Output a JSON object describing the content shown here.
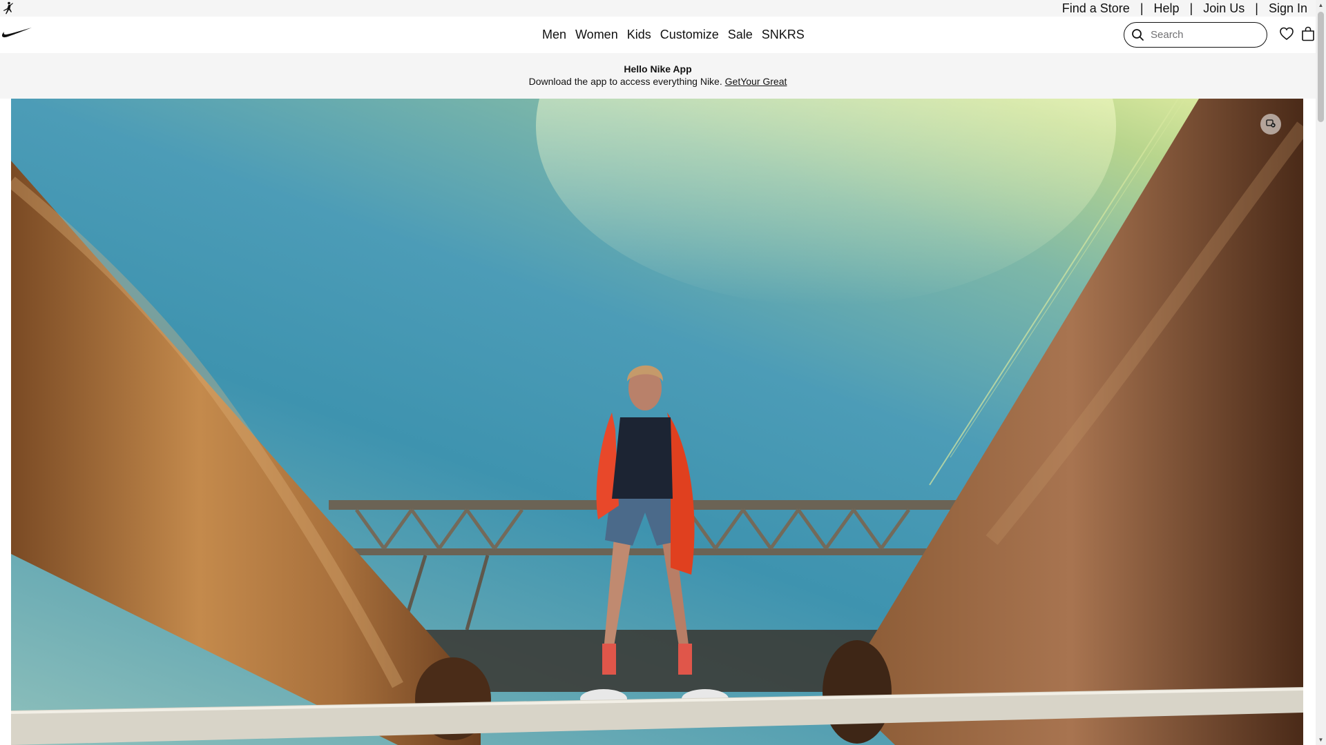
{
  "utility_bar": {
    "logo_icon": "jordan-jumpman-icon",
    "links": [
      "Find a Store",
      "Help",
      "Join Us",
      "Sign In"
    ],
    "separator": "|"
  },
  "header": {
    "logo_icon": "nike-swoosh-icon",
    "nav": [
      "Men",
      "Women",
      "Kids",
      "Customize",
      "Sale",
      "SNKRS"
    ],
    "search": {
      "placeholder": "Search",
      "value": "",
      "icon": "search-icon"
    },
    "favorites_icon": "heart-icon",
    "bag_icon": "shopping-bag-icon"
  },
  "promo": {
    "title": "Hello Nike App",
    "text": "Download the app to access everything Nike.",
    "link": "GetYour Great"
  },
  "hero": {
    "media": "video",
    "control_icon": "video-control-icon"
  },
  "colors": {
    "text": "#111111",
    "utility_bg": "#f5f5f5",
    "promo_bg": "#f5f5f5",
    "jacket": "#e8482a",
    "pipe": "#a36a38"
  }
}
